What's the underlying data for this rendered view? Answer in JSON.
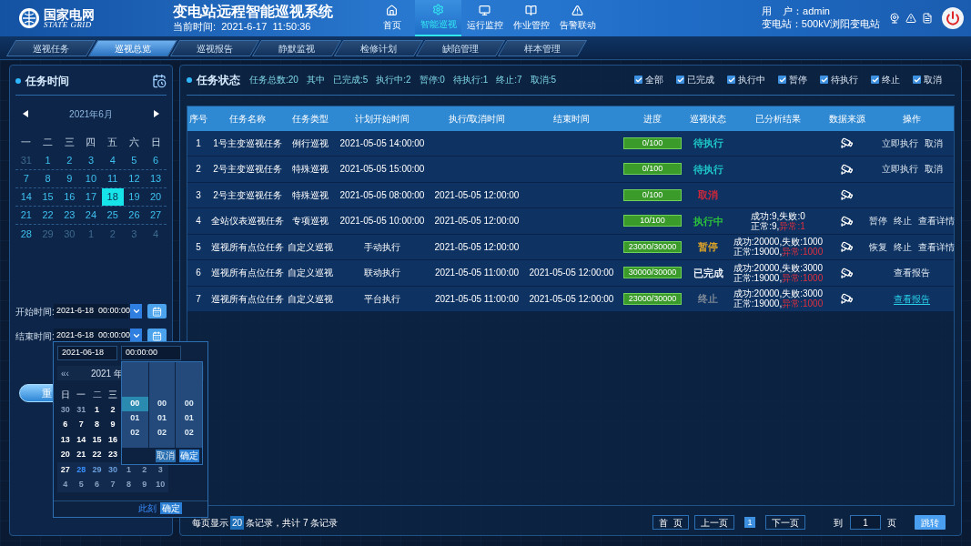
{
  "header": {
    "logo_cn": "国家电网",
    "logo_en": "STATE GRID",
    "title": "变电站远程智能巡视系统",
    "time": "当前时间:  2021-6-17  11:50:36",
    "nav": [
      {
        "label": "首页",
        "selected": false
      },
      {
        "label": "智能巡视",
        "selected": true
      },
      {
        "label": "运行监控",
        "selected": false
      },
      {
        "label": "作业管控",
        "selected": false
      },
      {
        "label": "告警联动",
        "selected": false
      }
    ],
    "user": "用    户：admin",
    "station": "变电站：500kV浏阳变电站"
  },
  "tabs": [
    {
      "label": "巡视任务",
      "selected": false
    },
    {
      "label": "巡视总览",
      "selected": true
    },
    {
      "label": "巡视报告",
      "selected": false
    },
    {
      "label": "静默监视",
      "selected": false
    },
    {
      "label": "检修计划",
      "selected": false
    },
    {
      "label": "缺陷管理",
      "selected": false
    },
    {
      "label": "样本管理",
      "selected": false
    }
  ],
  "calendar": {
    "title": "任务时间",
    "month": "2021年6月",
    "weekdays": [
      "一",
      "二",
      "三",
      "四",
      "五",
      "六",
      "日"
    ],
    "weeks": [
      [
        {
          "d": "31",
          "muted": true,
          "selected": false
        },
        {
          "d": "1",
          "muted": false,
          "selected": false
        },
        {
          "d": "2",
          "muted": false,
          "selected": false
        },
        {
          "d": "3",
          "muted": false,
          "selected": false
        },
        {
          "d": "4",
          "muted": false,
          "selected": false
        },
        {
          "d": "5",
          "muted": false,
          "selected": false
        },
        {
          "d": "6",
          "muted": false,
          "selected": false
        }
      ],
      [
        {
          "d": "7",
          "muted": false,
          "selected": false
        },
        {
          "d": "8",
          "muted": false,
          "selected": false
        },
        {
          "d": "9",
          "muted": false,
          "selected": false
        },
        {
          "d": "10",
          "muted": false,
          "selected": false
        },
        {
          "d": "11",
          "muted": false,
          "selected": false
        },
        {
          "d": "12",
          "muted": false,
          "selected": false
        },
        {
          "d": "13",
          "muted": false,
          "selected": false
        }
      ],
      [
        {
          "d": "14",
          "muted": false,
          "selected": false
        },
        {
          "d": "15",
          "muted": false,
          "selected": false
        },
        {
          "d": "16",
          "muted": false,
          "selected": false
        },
        {
          "d": "17",
          "muted": false,
          "selected": false
        },
        {
          "d": "18",
          "muted": false,
          "selected": true
        },
        {
          "d": "19",
          "muted": false,
          "selected": false
        },
        {
          "d": "20",
          "muted": false,
          "selected": false
        }
      ],
      [
        {
          "d": "21",
          "muted": false,
          "selected": false
        },
        {
          "d": "22",
          "muted": false,
          "selected": false
        },
        {
          "d": "23",
          "muted": false,
          "selected": false
        },
        {
          "d": "24",
          "muted": false,
          "selected": false
        },
        {
          "d": "25",
          "muted": false,
          "selected": false
        },
        {
          "d": "26",
          "muted": false,
          "selected": false
        },
        {
          "d": "27",
          "muted": false,
          "selected": false
        }
      ],
      [
        {
          "d": "28",
          "muted": false,
          "selected": false
        },
        {
          "d": "29",
          "muted": true,
          "selected": false
        },
        {
          "d": "30",
          "muted": true,
          "selected": false
        },
        {
          "d": "1",
          "muted": true,
          "selected": false
        },
        {
          "d": "2",
          "muted": true,
          "selected": false
        },
        {
          "d": "3",
          "muted": true,
          "selected": false
        },
        {
          "d": "4",
          "muted": true,
          "selected": false
        }
      ]
    ]
  },
  "time_fields": [
    {
      "label": "开始时间:",
      "value": "2021-6-18  00:00:00"
    },
    {
      "label": "结束时间:",
      "value": "2021-6-18  00:00:00"
    }
  ],
  "reset_button": "重",
  "date_popup": {
    "date_input": "2021-06-18",
    "time_input": "00:00:00",
    "prev": "«‹",
    "month": "2021 年",
    "weekdays": [
      "日",
      "一",
      "二",
      "三"
    ],
    "weeks": [
      [
        {
          "d": "30",
          "kind": "other"
        },
        {
          "d": "31",
          "kind": "other"
        },
        {
          "d": "1",
          "kind": "day"
        },
        {
          "d": "2",
          "kind": "day"
        }
      ],
      [
        {
          "d": "6",
          "kind": "day"
        },
        {
          "d": "7",
          "kind": "day"
        },
        {
          "d": "8",
          "kind": "day"
        },
        {
          "d": "9",
          "kind": "day"
        }
      ],
      [
        {
          "d": "13",
          "kind": "day"
        },
        {
          "d": "14",
          "kind": "day"
        },
        {
          "d": "15",
          "kind": "day"
        },
        {
          "d": "16",
          "kind": "day"
        }
      ],
      [
        {
          "d": "20",
          "kind": "day"
        },
        {
          "d": "21",
          "kind": "day"
        },
        {
          "d": "22",
          "kind": "day"
        },
        {
          "d": "23",
          "kind": "day"
        }
      ],
      [
        {
          "d": "27",
          "kind": "day"
        },
        {
          "d": "28",
          "kind": "today"
        },
        {
          "d": "29",
          "kind": "range"
        },
        {
          "d": "30",
          "kind": "range"
        },
        {
          "d": "1",
          "kind": "other"
        },
        {
          "d": "2",
          "kind": "other"
        },
        {
          "d": "3",
          "kind": "other"
        }
      ],
      [
        {
          "d": "4",
          "kind": "other"
        },
        {
          "d": "5",
          "kind": "other"
        },
        {
          "d": "6",
          "kind": "other"
        },
        {
          "d": "7",
          "kind": "other"
        },
        {
          "d": "8",
          "kind": "other"
        },
        {
          "d": "9",
          "kind": "other"
        },
        {
          "d": "10",
          "kind": "other"
        }
      ]
    ],
    "time_columns": [
      [
        {
          "v": "00",
          "selected": true
        },
        {
          "v": "01",
          "selected": false
        },
        {
          "v": "02",
          "selected": false
        }
      ],
      [
        {
          "v": "00",
          "selected": false
        },
        {
          "v": "01",
          "selected": false
        },
        {
          "v": "02",
          "selected": false
        }
      ],
      [
        {
          "v": "00",
          "selected": false
        },
        {
          "v": "01",
          "selected": false
        },
        {
          "v": "02",
          "selected": false
        }
      ]
    ],
    "time_cancel": "取消",
    "time_ok": "确定",
    "now": "此刻",
    "ok": "确定"
  },
  "task_status": {
    "title": "任务状态",
    "summary": [
      "任务总数:20",
      "其中",
      "已完成:5",
      "执行中:2",
      "暂停:0",
      "待执行:1",
      "终止:7",
      "取消:5"
    ],
    "filters": [
      {
        "label": "全部",
        "checked": true
      },
      {
        "label": "已完成",
        "checked": true
      },
      {
        "label": "执行中",
        "checked": true
      },
      {
        "label": "暂停",
        "checked": true
      },
      {
        "label": "待执行",
        "checked": true
      },
      {
        "label": "终止",
        "checked": true
      },
      {
        "label": "取消",
        "checked": true
      }
    ]
  },
  "table": {
    "columns": [
      "序号",
      "任务名称",
      "任务类型",
      "计划开始时间",
      "执行/取消时间",
      "结束时间",
      "进度",
      "巡视状态",
      "已分析结果",
      "数据来源",
      "操作"
    ],
    "rows": [
      {
        "no": "1",
        "name": "1号主变巡视任务",
        "type": "例行巡视",
        "plan_start": "2021-05-05 14:00:00",
        "progress": "0/100",
        "status": {
          "text": "待执行",
          "color": "#1ec8c8"
        },
        "actions": [
          {
            "label": "立即执行",
            "kind": "text"
          },
          {
            "label": "取消",
            "kind": "text"
          }
        ]
      },
      {
        "no": "2",
        "name": "2号主变巡视任务",
        "type": "特殊巡视",
        "plan_start": "2021-05-05 15:00:00",
        "progress": "0/100",
        "status": {
          "text": "待执行",
          "color": "#1ec8c8"
        },
        "actions": [
          {
            "label": "立即执行",
            "kind": "text"
          },
          {
            "label": "取消",
            "kind": "text"
          }
        ]
      },
      {
        "no": "3",
        "name": "2号主变巡视任务",
        "type": "特殊巡视",
        "plan_start": "2021-05-05 08:00:00",
        "exec_time": "2021-05-05 12:00:00",
        "progress": "0/100",
        "status": {
          "text": "取消",
          "color": "#d0283a"
        }
      },
      {
        "no": "4",
        "name": "全站仪表巡视任务",
        "type": "专项巡视",
        "plan_start": "2021-05-05 10:00:00",
        "exec_time": "2021-05-05 12:00:00",
        "progress": "10/100",
        "status": {
          "text": "执行中",
          "color": "#2cc23c"
        },
        "result": {
          "line1": "成功:9,失败:0",
          "normal": "正常:9,",
          "abnormal": "异常:1"
        },
        "actions": [
          {
            "label": "暂停",
            "kind": "text"
          },
          {
            "label": "终止",
            "kind": "text"
          },
          {
            "label": "查看详情",
            "kind": "text"
          }
        ]
      },
      {
        "no": "5",
        "name": "巡视所有点位任务",
        "type": "自定义巡视",
        "plan_start": "手动执行",
        "exec_time": "2021-05-05 12:00:00",
        "progress": "23000/30000",
        "status": {
          "text": "暂停",
          "color": "#d9a12a"
        },
        "result": {
          "line1": "成功:20000,失败:1000",
          "normal": "正常:19000,",
          "abnormal": "异常:1000"
        },
        "actions": [
          {
            "label": "恢复",
            "kind": "text"
          },
          {
            "label": "终止",
            "kind": "text"
          },
          {
            "label": "查看详情",
            "kind": "text"
          }
        ]
      },
      {
        "no": "6",
        "name": "巡视所有点位任务",
        "type": "自定义巡视",
        "plan_start": "联动执行",
        "exec_time": "2021-05-05 11:00:00",
        "end_time": "2021-05-05 12:00:00",
        "progress": "30000/30000",
        "status": {
          "text": "已完成",
          "color": "#e8eef5"
        },
        "result": {
          "line1": "成功:20000,失败:3000",
          "normal": "正常:19000,",
          "abnormal": "异常:1000"
        },
        "actions": [
          {
            "label": "查看报告",
            "kind": "text"
          }
        ]
      },
      {
        "no": "7",
        "name": "巡视所有点位任务",
        "type": "自定义巡视",
        "plan_start": "平台执行",
        "exec_time": "2021-05-05 11:00:00",
        "end_time": "2021-05-05 12:00:00",
        "progress": "23000/30000",
        "status": {
          "text": "终止",
          "color": "#7d8896"
        },
        "result": {
          "line1": "成功:20000,失败:3000",
          "normal": "正常:19000,",
          "abnormal": "异常:1000"
        },
        "actions": [
          {
            "label": "查看报告",
            "kind": "link"
          }
        ]
      }
    ]
  },
  "pagination": {
    "prefix": "每页显示",
    "per_page": "20",
    "summary": "条记录，共计 7 条记录",
    "first": "首  页",
    "prev": "上一页",
    "pages": [
      {
        "label": "1",
        "selected": true
      }
    ],
    "next": "下一页",
    "goto": "到",
    "goto_value": "1",
    "unit": "页",
    "jump": "跳转"
  }
}
